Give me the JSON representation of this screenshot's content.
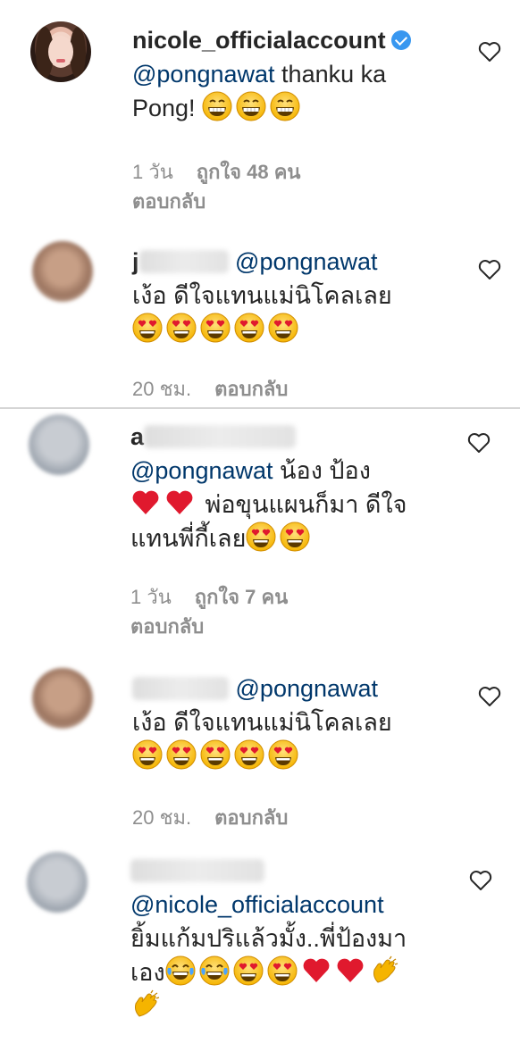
{
  "comments": [
    {
      "username": "nicole_officialaccount",
      "verified": true,
      "mention": "@pongnawat",
      "text": "thanku ka Pong!",
      "emojis": [
        "grin-emoji",
        "grin-emoji",
        "grin-emoji"
      ],
      "time": "1 วัน",
      "likes": "ถูกใจ 48 คน",
      "reply": "ตอบกลับ"
    },
    {
      "username_visible": "j",
      "mention": "@pongnawat",
      "text": "เง้อ ดีใจแทนแม่นิโคลเลย",
      "emojis": [
        "heart-eyes-emoji",
        "heart-eyes-emoji",
        "heart-eyes-emoji",
        "heart-eyes-emoji",
        "heart-eyes-emoji"
      ],
      "time": "20 ชม.",
      "reply": "ตอบกลับ"
    },
    {
      "username_visible": "a",
      "mention": "@pongnawat",
      "text_line1": "น้อง ป้อง",
      "text_line2": "พ่อขุนแผนก็มา ดีใจ",
      "text_line3": "แทนพี่กี้เลย",
      "time": "1 วัน",
      "likes": "ถูกใจ 7 คน",
      "reply": "ตอบกลับ"
    },
    {
      "mention": "@pongnawat",
      "text": "เง้อ ดีใจแทนแม่นิโคลเลย",
      "emojis": [
        "heart-eyes-emoji",
        "heart-eyes-emoji",
        "heart-eyes-emoji",
        "heart-eyes-emoji",
        "heart-eyes-emoji"
      ],
      "time": "20 ชม.",
      "reply": "ตอบกลับ"
    },
    {
      "mention": "@nicole_officialaccount",
      "text_line1": "ยิ้มแก้มปริแล้วมั้ง..พี่ป้องมา",
      "text_line2": "เอง"
    }
  ],
  "colors": {
    "mention": "#00376b",
    "meta": "#8e8e8e",
    "verified": "#3897f0"
  }
}
